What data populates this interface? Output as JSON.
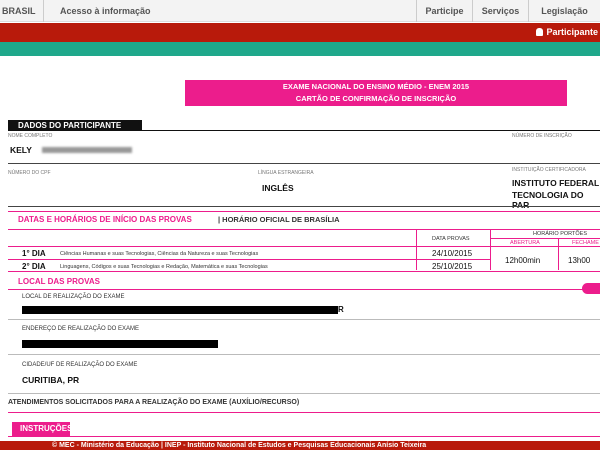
{
  "govbar": {
    "brasil": "BRASIL",
    "acesso": "Acesso à informação",
    "nav": [
      "Participe",
      "Serviços",
      "Legislação"
    ]
  },
  "redbar": {
    "participante": "Participante"
  },
  "header": {
    "line1": "EXAME NACIONAL DO ENSINO MÉDIO - ENEM 2015",
    "line2": "CARTÃO DE CONFIRMAÇÃO DE INSCRIÇÃO"
  },
  "dados": {
    "title": "DADOS DO PARTICIPANTE",
    "nome_label": "NOME COMPLETO",
    "nome_value": "KELY",
    "inscricao_label": "NÚMERO DE INSCRIÇÃO",
    "cpf_label": "NÚMERO DO CPF",
    "lingua_label": "LÍNGUA ESTRANGEIRA",
    "lingua_value": "INGLÊS",
    "instituicao_label": "INSTITUIÇÃO CERTIFICADORA",
    "instituicao_line1": "INSTITUTO FEDERAL",
    "instituicao_line2": "TECNOLOGIA DO PAR"
  },
  "datas": {
    "title": "DATAS E HORÁRIOS DE INÍCIO DAS PROVAS",
    "oficial": "| HORÁRIO OFICIAL DE BRASÍLIA",
    "col_data": "DATA PROVAS",
    "col_horario": "HORÁRIO PORTÕES",
    "col_abertura": "ABERTURA",
    "col_fechamento": "FECHAME",
    "rows": [
      {
        "dia": "1° DIA",
        "desc": "Ciências Humanas e suas Tecnologias, Ciências da Natureza e suas Tecnologias",
        "data": "24/10/2015"
      },
      {
        "dia": "2° DIA",
        "desc": "Linguagens, Códigos e suas Tecnologias e Redação, Matemática e suas Tecnologias",
        "data": "25/10/2015"
      }
    ],
    "abertura": "12h00min",
    "fechamento": "13h00"
  },
  "local": {
    "title": "LOCAL DAS PROVAS",
    "local_label": "LOCAL DE REALIZAÇÃO DO EXAME",
    "local_tail": "R",
    "endereco_label": "ENDEREÇO DE REALIZAÇÃO DO EXAME",
    "cidade_label": "CIDADE/UF DE REALIZAÇÃO DO EXAME",
    "cidade_value": "CURITIBA, PR"
  },
  "atendimentos": "ATENDIMENTOS SOLICITADOS PARA A REALIZAÇÃO DO EXAME (AUXÍLIO/RECURSO)",
  "instrucoes": "INSTRUÇÕES",
  "footer": "© MEC - Ministério da Educação | INEP - Instituto Nacional de Estudos e Pesquisas Educacionais Anísio Teixeira",
  "colors": {
    "pink": "#ec1d8c",
    "red": "#b81a0b",
    "teal": "#1fa88b"
  }
}
